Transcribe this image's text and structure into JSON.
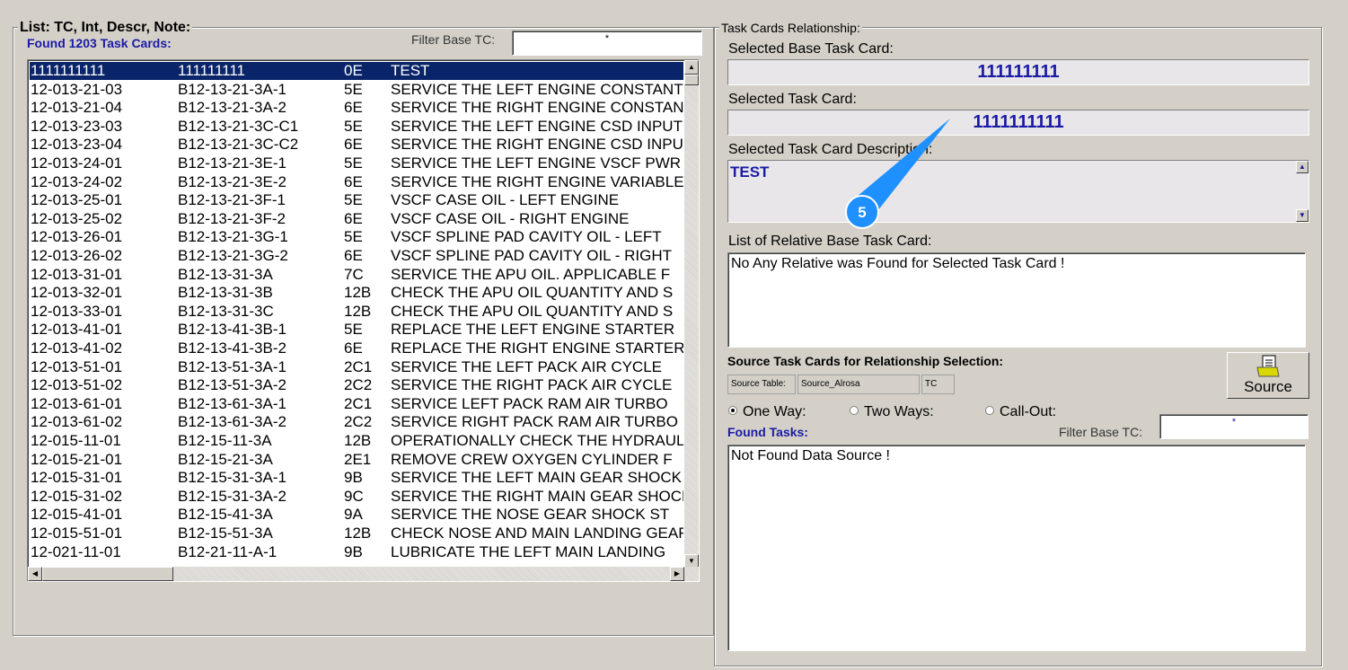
{
  "left_panel": {
    "title": "List: TC, Int, Descr, Note:",
    "found": "Found 1203 Task Cards:",
    "filter_label": "Filter Base TC:",
    "filter_value": "*",
    "rows": [
      [
        "1111111111",
        "111111111",
        "0E",
        "TEST"
      ],
      [
        "12-013-21-03",
        "B12-13-21-3A-1",
        "5E",
        "SERVICE THE LEFT ENGINE CONSTANT"
      ],
      [
        "12-013-21-04",
        "B12-13-21-3A-2",
        "6E",
        "SERVICE THE RIGHT ENGINE CONSTANT"
      ],
      [
        "12-013-23-03",
        "B12-13-21-3C-C1",
        "5E",
        "SERVICE THE LEFT ENGINE CSD INPUT"
      ],
      [
        "12-013-23-04",
        "B12-13-21-3C-C2",
        "6E",
        "SERVICE THE RIGHT ENGINE CSD INPUT"
      ],
      [
        "12-013-24-01",
        "B12-13-21-3E-1",
        "5E",
        "SERVICE THE LEFT ENGINE VSCF PWR"
      ],
      [
        "12-013-24-02",
        "B12-13-21-3E-2",
        "6E",
        "SERVICE THE RIGHT ENGINE VARIABLE"
      ],
      [
        "12-013-25-01",
        "B12-13-21-3F-1",
        "5E",
        "VSCF CASE OIL - LEFT ENGINE"
      ],
      [
        "12-013-25-02",
        "B12-13-21-3F-2",
        "6E",
        "VSCF CASE OIL - RIGHT ENGINE"
      ],
      [
        "12-013-26-01",
        "B12-13-21-3G-1",
        "5E",
        "VSCF SPLINE PAD CAVITY OIL - LEFT"
      ],
      [
        "12-013-26-02",
        "B12-13-21-3G-2",
        "6E",
        "VSCF SPLINE PAD CAVITY OIL - RIGHT"
      ],
      [
        "12-013-31-01",
        "B12-13-31-3A",
        "7C",
        "SERVICE THE APU OIL. APPLICABLE F"
      ],
      [
        "12-013-32-01",
        "B12-13-31-3B",
        "12B",
        "CHECK THE APU OIL QUANTITY AND S"
      ],
      [
        "12-013-33-01",
        "B12-13-31-3C",
        "12B",
        "CHECK THE APU OIL QUANTITY AND S"
      ],
      [
        "12-013-41-01",
        "B12-13-41-3B-1",
        "5E",
        "REPLACE THE LEFT ENGINE STARTER"
      ],
      [
        "12-013-41-02",
        "B12-13-41-3B-2",
        "6E",
        "REPLACE THE RIGHT ENGINE STARTER"
      ],
      [
        "12-013-51-01",
        "B12-13-51-3A-1",
        "2C1",
        "SERVICE THE LEFT PACK AIR CYCLE"
      ],
      [
        "12-013-51-02",
        "B12-13-51-3A-2",
        "2C2",
        "SERVICE THE RIGHT PACK AIR CYCLE"
      ],
      [
        "12-013-61-01",
        "B12-13-61-3A-1",
        "2C1",
        "SERVICE LEFT PACK RAM AIR TURBO"
      ],
      [
        "12-013-61-02",
        "B12-13-61-3A-2",
        "2C2",
        "SERVICE RIGHT PACK RAM AIR TURBO"
      ],
      [
        "12-015-11-01",
        "B12-15-11-3A",
        "12B",
        "OPERATIONALLY CHECK THE HYDRAULIC"
      ],
      [
        "12-015-21-01",
        "B12-15-21-3A",
        "2E1",
        "REMOVE CREW OXYGEN CYLINDER F"
      ],
      [
        "12-015-31-01",
        "B12-15-31-3A-1",
        "9B",
        "SERVICE THE LEFT MAIN GEAR SHOCK"
      ],
      [
        "12-015-31-02",
        "B12-15-31-3A-2",
        "9C",
        "SERVICE THE RIGHT MAIN GEAR SHOCK"
      ],
      [
        "12-015-41-01",
        "B12-15-41-3A",
        "9A",
        "SERVICE THE NOSE GEAR SHOCK ST"
      ],
      [
        "12-015-51-01",
        "B12-15-51-3A",
        "12B",
        "CHECK NOSE AND MAIN LANDING GEAR"
      ],
      [
        "12-021-11-01",
        "B12-21-11-A-1",
        "9B",
        "LUBRICATE THE LEFT MAIN LANDING"
      ]
    ]
  },
  "right_panel": {
    "title": "Task Cards Relationship:",
    "base_label": "Selected Base Task Card:",
    "base_value": "111111111",
    "tc_label": "Selected Task Card:",
    "tc_value": "1111111111",
    "desc_label": "Selected Task Card Description:",
    "desc_value": "TEST",
    "relative_label": "List of Relative Base Task Card:",
    "relative_value": "No Any Relative was Found for Selected Task Card !",
    "source_label": "Source Task Cards for Relationship Selection:",
    "source_table_label": "Source Table:",
    "source_table_value": "Source_Alrosa",
    "source_field": "TC",
    "source_button": "Source",
    "radio_one": "One Way:",
    "radio_two": "Two Ways:",
    "radio_call": "Call-Out:",
    "found_tasks": "Found Tasks:",
    "filter_label": "Filter Base TC:",
    "filter_value": "*",
    "tasks_value": "Not Found Data Source !"
  },
  "annotation": {
    "marker": "5",
    "color": "#1e90ff"
  }
}
